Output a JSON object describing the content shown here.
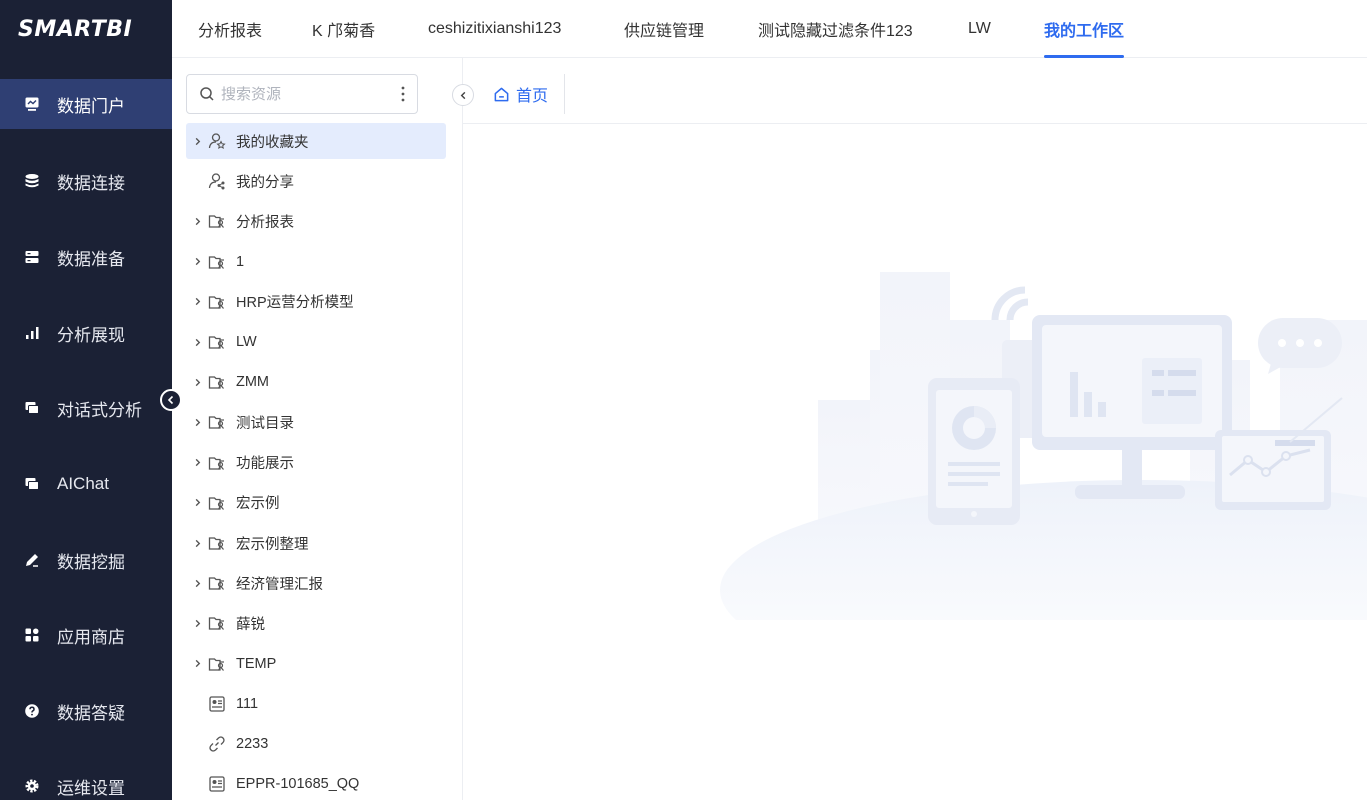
{
  "app": {
    "logo": "SMARTBI"
  },
  "sidebar": {
    "items": [
      {
        "label": "数据门户",
        "icon": "monitor-icon",
        "active": true
      },
      {
        "label": "数据连接",
        "icon": "database-icon"
      },
      {
        "label": "数据准备",
        "icon": "server-icon"
      },
      {
        "label": "分析展现",
        "icon": "bar-chart-icon"
      },
      {
        "label": "对话式分析",
        "icon": "chat-icon"
      },
      {
        "label": "AIChat",
        "icon": "chat-icon"
      },
      {
        "label": "数据挖掘",
        "icon": "pen-icon"
      },
      {
        "label": "应用商店",
        "icon": "grid-icon"
      },
      {
        "label": "数据答疑",
        "icon": "question-icon"
      },
      {
        "label": "运维设置",
        "icon": "gear-icon"
      }
    ]
  },
  "topbar": {
    "tabs": [
      {
        "label": "分析报表"
      },
      {
        "label": "K 邝菊香"
      },
      {
        "label": "ceshizitixianshi123"
      },
      {
        "label": "供应链管理"
      },
      {
        "label": "测试隐藏过滤条件123"
      },
      {
        "label": "LW"
      },
      {
        "label": "我的工作区",
        "active": true
      }
    ]
  },
  "panel": {
    "search_placeholder": "搜索资源",
    "tree": [
      {
        "label": "我的收藏夹",
        "icon": "favorites-icon",
        "expandable": true,
        "selected": true
      },
      {
        "label": "我的分享",
        "icon": "share-user-icon",
        "expandable": false
      },
      {
        "label": "分析报表",
        "icon": "folder-icon",
        "expandable": true
      },
      {
        "label": "1",
        "icon": "folder-icon",
        "expandable": true
      },
      {
        "label": "HRP运营分析模型",
        "icon": "folder-icon",
        "expandable": true
      },
      {
        "label": "LW",
        "icon": "folder-icon",
        "expandable": true
      },
      {
        "label": "ZMM",
        "icon": "folder-icon",
        "expandable": true
      },
      {
        "label": "测试目录",
        "icon": "folder-icon",
        "expandable": true
      },
      {
        "label": "功能展示",
        "icon": "folder-icon",
        "expandable": true
      },
      {
        "label": "宏示例",
        "icon": "folder-icon",
        "expandable": true
      },
      {
        "label": "宏示例整理",
        "icon": "folder-icon",
        "expandable": true
      },
      {
        "label": "经济管理汇报",
        "icon": "folder-icon",
        "expandable": true
      },
      {
        "label": "薛锐",
        "icon": "folder-icon",
        "expandable": true
      },
      {
        "label": "TEMP",
        "icon": "folder-icon",
        "expandable": true
      },
      {
        "label": "111",
        "icon": "report-icon",
        "expandable": false
      },
      {
        "label": "2233",
        "icon": "link-icon",
        "expandable": false
      },
      {
        "label": "EPPR-101685_QQ",
        "icon": "report-icon",
        "expandable": false
      }
    ]
  },
  "main": {
    "home_tab": "首页"
  },
  "colors": {
    "sidebar_bg": "#1b2135",
    "sidebar_active": "#2f3f73",
    "accent": "#2e6bef",
    "selected_row": "#e4ecfd"
  }
}
